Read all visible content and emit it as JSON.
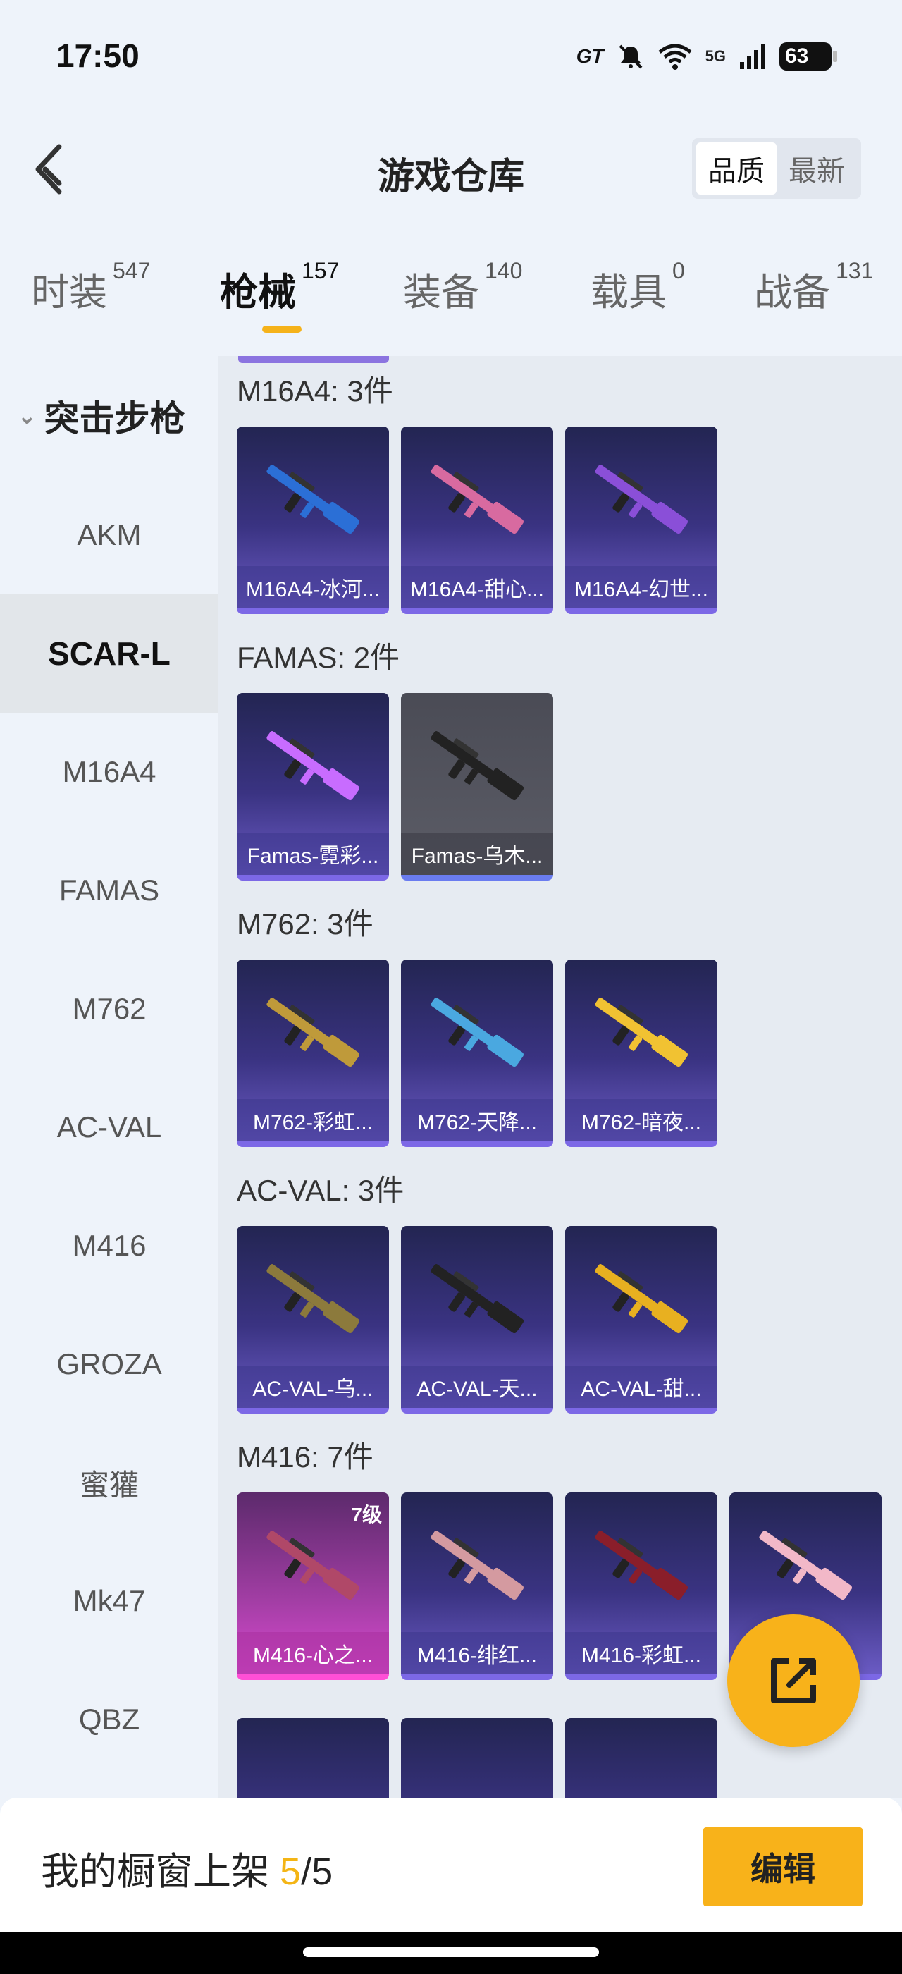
{
  "status": {
    "time": "17:50",
    "carrier_tag": "GT",
    "network": "5G",
    "battery": "63"
  },
  "header": {
    "title": "游戏仓库",
    "sort_options": [
      "品质",
      "最新"
    ],
    "sort_active": "品质"
  },
  "tabs": [
    {
      "label": "时装",
      "count": "547"
    },
    {
      "label": "枪械",
      "count": "157"
    },
    {
      "label": "装备",
      "count": "140"
    },
    {
      "label": "载具",
      "count": "0"
    },
    {
      "label": "战备",
      "count": "131"
    }
  ],
  "sidebar": {
    "category": "突击步枪",
    "items": [
      "AKM",
      "SCAR-L",
      "M16A4",
      "FAMAS",
      "M762",
      "AC-VAL",
      "M416",
      "GROZA",
      "蜜獾",
      "Mk47",
      "QBZ"
    ],
    "active": "SCAR-L"
  },
  "groups": [
    {
      "title": "M16A4: 3件",
      "items": [
        {
          "label": "M16A4-冰河...",
          "style": "purple"
        },
        {
          "label": "M16A4-甜心...",
          "style": "purple"
        },
        {
          "label": "M16A4-幻世...",
          "style": "purple"
        }
      ]
    },
    {
      "title": "FAMAS: 2件",
      "items": [
        {
          "label": "Famas-霓彩...",
          "style": "purple"
        },
        {
          "label": "Famas-乌木...",
          "style": "grey"
        }
      ]
    },
    {
      "title": "M762: 3件",
      "items": [
        {
          "label": "M762-彩虹...",
          "style": "purple"
        },
        {
          "label": "M762-天降...",
          "style": "purple"
        },
        {
          "label": "M762-暗夜...",
          "style": "purple"
        }
      ]
    },
    {
      "title": "AC-VAL: 3件",
      "items": [
        {
          "label": "AC-VAL-乌...",
          "style": "purple"
        },
        {
          "label": "AC-VAL-天...",
          "style": "purple"
        },
        {
          "label": "AC-VAL-甜...",
          "style": "purple"
        }
      ]
    },
    {
      "title": "M416: 7件",
      "items": [
        {
          "label": "M416-心之...",
          "style": "pink",
          "badge": "7级"
        },
        {
          "label": "M416-绯红...",
          "style": "purple"
        },
        {
          "label": "M416-彩虹...",
          "style": "purple"
        },
        {
          "label": "",
          "style": "purple"
        }
      ]
    }
  ],
  "bottom": {
    "showcase_prefix": "我的橱窗上架 ",
    "showcase_count": "5",
    "showcase_total": "/5",
    "edit_label": "编辑"
  },
  "colors": {
    "accent": "#f8b21a",
    "card_purple": "#3a3382",
    "card_pink": "#a33ea5"
  }
}
